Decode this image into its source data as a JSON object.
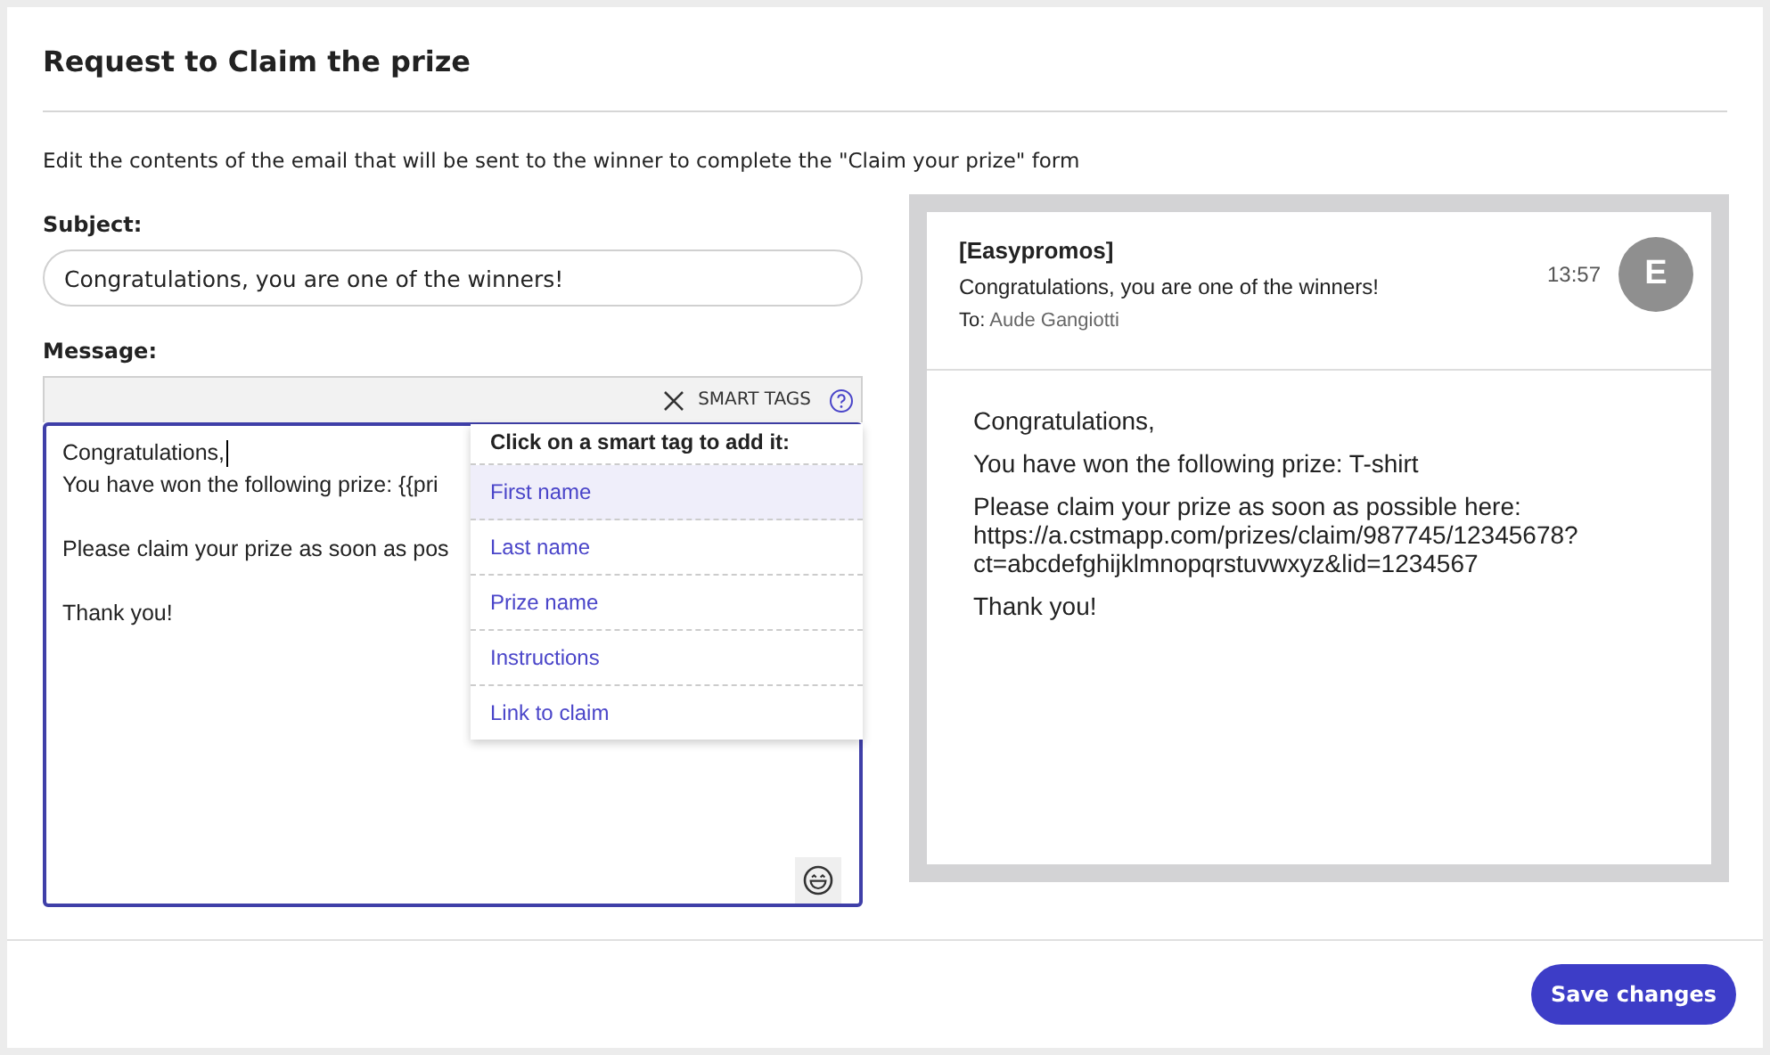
{
  "title": "Request to Claim the prize",
  "description": "Edit the contents of the email that will be sent to the winner to complete the \"Claim your prize\" form",
  "subject": {
    "label": "Subject:",
    "value": "Congratulations, you are one of the winners!"
  },
  "message": {
    "label": "Message:",
    "toolbar_label": "SMART TAGS",
    "paragraphs": [
      [
        "Congratulations,",
        "You have won the following prize: {{pri"
      ],
      [
        "Please claim your prize as soon as pos"
      ],
      [
        "Thank you!"
      ]
    ]
  },
  "smart_tags": {
    "heading": "Click on a smart tag to add it:",
    "items": [
      {
        "label": "First name",
        "selected": true
      },
      {
        "label": "Last name",
        "selected": false
      },
      {
        "label": "Prize name",
        "selected": false
      },
      {
        "label": "Instructions",
        "selected": false
      },
      {
        "label": "Link to claim",
        "selected": false
      }
    ]
  },
  "preview": {
    "sender": "[Easypromos]",
    "subject": "Congratulations, you are one of the winners!",
    "to_label": "To:",
    "to": "Aude Gangiotti",
    "time": "13:57",
    "avatar": "E",
    "paragraphs": [
      [
        "Congratulations,"
      ],
      [
        "You have won the following prize: T-shirt"
      ],
      [
        "Please claim your prize as soon as possible here:",
        "https://a.cstmapp.com/prizes/claim/987745/12345678?",
        "ct=abcdefghijklmnopqrstuvwxyz&lid=1234567"
      ],
      [
        "Thank you!"
      ]
    ]
  },
  "save_button": "Save changes"
}
